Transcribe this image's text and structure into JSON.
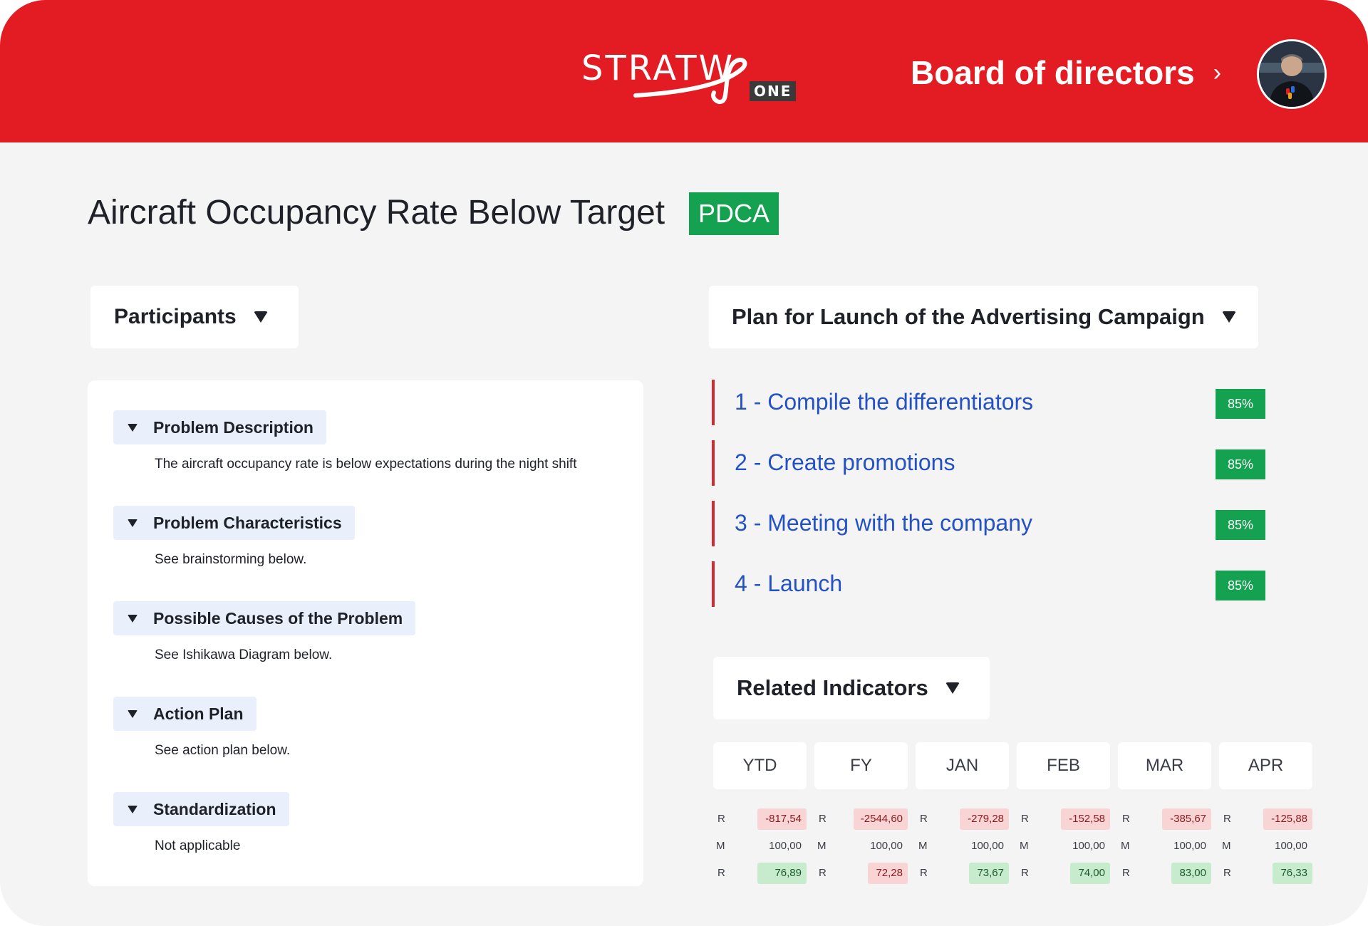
{
  "header": {
    "logo_text": "STRATW",
    "logo_badge": "ONE",
    "board_label": "Board of directors",
    "board_chevron": "›",
    "avatar_icon": "user-avatar-icon"
  },
  "page": {
    "title": "Aircraft Occupancy Rate Below Target",
    "method_badge": "PDCA"
  },
  "participants": {
    "label": "Participants"
  },
  "sections": [
    {
      "heading": "Problem Description",
      "text": "The aircraft occupancy rate is below expectations during the night shift"
    },
    {
      "heading": "Problem Characteristics",
      "text": "See brainstorming below."
    },
    {
      "heading": "Possible Causes of the Problem",
      "text": "See Ishikawa Diagram below."
    },
    {
      "heading": "Action Plan",
      "text": "See action plan below."
    },
    {
      "heading": "Standardization",
      "text": "Not applicable"
    }
  ],
  "plan": {
    "title": "Plan for Launch of the Advertising Campaign",
    "items": [
      {
        "label": "1 - Compile the differentiators",
        "progress": "85%"
      },
      {
        "label": "2 - Create promotions",
        "progress": "85%"
      },
      {
        "label": "3 - Meeting with the company",
        "progress": "85%"
      },
      {
        "label": "4 - Launch",
        "progress": "85%"
      }
    ]
  },
  "indicators": {
    "title": "Related Indicators",
    "columns": [
      {
        "name": "YTD",
        "rows": [
          {
            "label": "R",
            "value": "-817,54",
            "status": "negative"
          },
          {
            "label": "M",
            "value": "100,00",
            "status": "neutral"
          },
          {
            "label": "R",
            "value": "76,89",
            "status": "positive"
          }
        ]
      },
      {
        "name": "FY",
        "rows": [
          {
            "label": "R",
            "value": "-2544,60",
            "status": "negative"
          },
          {
            "label": "M",
            "value": "100,00",
            "status": "neutral"
          },
          {
            "label": "R",
            "value": "72,28",
            "status": "negative"
          }
        ]
      },
      {
        "name": "JAN",
        "rows": [
          {
            "label": "R",
            "value": "-279,28",
            "status": "negative"
          },
          {
            "label": "M",
            "value": "100,00",
            "status": "neutral"
          },
          {
            "label": "R",
            "value": "73,67",
            "status": "positive"
          }
        ]
      },
      {
        "name": "FEB",
        "rows": [
          {
            "label": "R",
            "value": "-152,58",
            "status": "negative"
          },
          {
            "label": "M",
            "value": "100,00",
            "status": "neutral"
          },
          {
            "label": "R",
            "value": "74,00",
            "status": "positive"
          }
        ]
      },
      {
        "name": "MAR",
        "rows": [
          {
            "label": "R",
            "value": "-385,67",
            "status": "negative"
          },
          {
            "label": "M",
            "value": "100,00",
            "status": "neutral"
          },
          {
            "label": "R",
            "value": "83,00",
            "status": "positive"
          }
        ]
      },
      {
        "name": "APR",
        "rows": [
          {
            "label": "R",
            "value": "-125,88",
            "status": "negative"
          },
          {
            "label": "M",
            "value": "100,00",
            "status": "neutral"
          },
          {
            "label": "R",
            "value": "76,33",
            "status": "positive"
          }
        ]
      }
    ]
  },
  "colors": {
    "brand_red": "#e31b23",
    "accent_green": "#14a150",
    "link_blue": "#2452c4",
    "negative_bg": "#f9d4d4",
    "positive_bg": "#c7ebcd"
  }
}
